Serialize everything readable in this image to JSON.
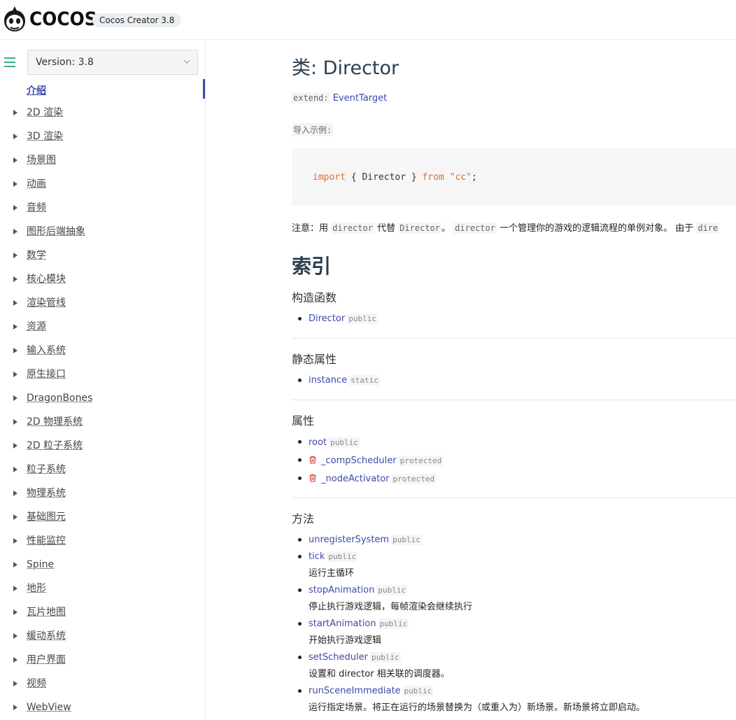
{
  "header": {
    "logo_text": "COCOS",
    "product_pill": "Cocos Creator 3.8"
  },
  "sidebar": {
    "version_label": "Version: 3.8",
    "active_item": "介绍",
    "items": [
      {
        "label": "2D 渲染"
      },
      {
        "label": "3D 渲染"
      },
      {
        "label": "场景图"
      },
      {
        "label": "动画"
      },
      {
        "label": "音频"
      },
      {
        "label": "图形后端抽象"
      },
      {
        "label": "数学"
      },
      {
        "label": "核心模块"
      },
      {
        "label": "渲染管线"
      },
      {
        "label": "资源"
      },
      {
        "label": "输入系统"
      },
      {
        "label": "原生接口"
      },
      {
        "label": "DragonBones"
      },
      {
        "label": "2D 物理系统"
      },
      {
        "label": "2D 粒子系统"
      },
      {
        "label": "粒子系统"
      },
      {
        "label": "物理系统"
      },
      {
        "label": "基础图元"
      },
      {
        "label": "性能监控"
      },
      {
        "label": "Spine"
      },
      {
        "label": "地形"
      },
      {
        "label": "瓦片地图"
      },
      {
        "label": "缓动系统"
      },
      {
        "label": "用户界面"
      },
      {
        "label": "视频"
      },
      {
        "label": "WebView"
      }
    ]
  },
  "main": {
    "title": "类: Director",
    "extend_label": "extend:",
    "extend_link": "EventTarget",
    "import_label": "导入示例:",
    "code": {
      "kw_import": "import",
      "middle": " { Director } ",
      "kw_from": "from",
      "str": " \"cc\"",
      "end": ";"
    },
    "note": {
      "p1": "注意：用 ",
      "c1": "director",
      "p2": " 代替 ",
      "c2": "Director",
      "p3": "。 ",
      "c3": "director",
      "p4": " 一个管理你的游戏的逻辑流程的单例对象。 由于 ",
      "c4": "dire"
    },
    "index_title": "索引",
    "sections": {
      "constructors": {
        "title": "构造函数",
        "items": [
          {
            "name": "Director",
            "tag": "public"
          }
        ]
      },
      "static_props": {
        "title": "静态属性",
        "items": [
          {
            "name": "instance",
            "tag": "static"
          }
        ]
      },
      "props": {
        "title": "属性",
        "items": [
          {
            "name": "root",
            "tag": "public"
          },
          {
            "name": "_compScheduler",
            "tag": "protected"
          },
          {
            "name": "_nodeActivator",
            "tag": "protected"
          }
        ]
      },
      "methods": {
        "title": "方法",
        "items": [
          {
            "name": "unregisterSystem",
            "tag": "public",
            "desc": ""
          },
          {
            "name": "tick",
            "tag": "public",
            "desc": "运行主循环"
          },
          {
            "name": "stopAnimation",
            "tag": "public",
            "desc": "停止执行游戏逻辑，每帧渲染会继续执行"
          },
          {
            "name": "startAnimation",
            "tag": "public",
            "desc": "开始执行游戏逻辑"
          },
          {
            "name": "setScheduler",
            "tag": "public",
            "desc": "设置和 director 相关联的调度器。"
          },
          {
            "name": "runSceneImmediate",
            "tag": "public",
            "desc": "运行指定场景。将正在运行的场景替换为（或重入为）新场景。新场景将立即启动。"
          }
        ]
      }
    }
  },
  "colors": {
    "link": "#3c4aa8",
    "accent": "#3eaf7c",
    "deprecated": "#d9342b"
  }
}
